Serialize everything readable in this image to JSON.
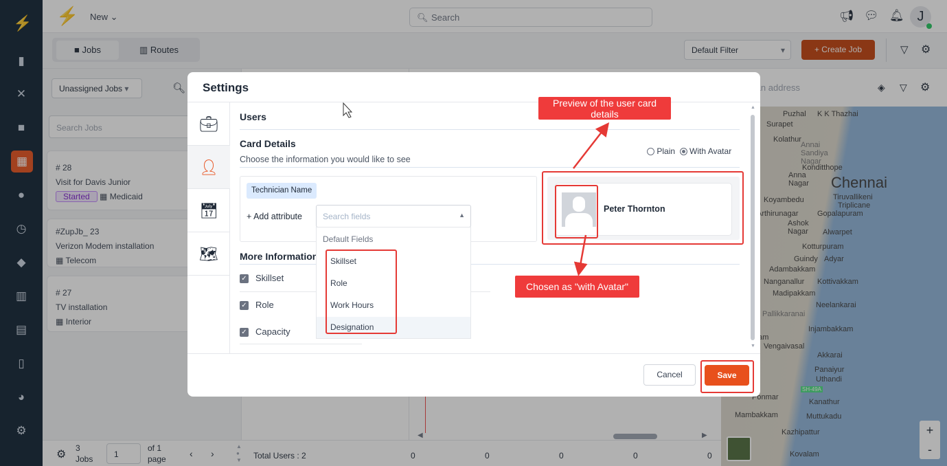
{
  "topbar": {
    "new_label": "New",
    "search_placeholder": "Search",
    "avatar_initial": "J"
  },
  "tabs": [
    {
      "label": "Jobs",
      "icon": "briefcase-icon"
    },
    {
      "label": "Routes",
      "icon": "map-icon"
    }
  ],
  "toolbar": {
    "filter_select": "Default Filter",
    "create_job": "+ Create Job"
  },
  "left_panel": {
    "jobs_filter": "Unassigned Jobs",
    "search_placeholder": "Search Jobs",
    "jobs": [
      {
        "id": "# 28",
        "title": "Visit for Davis Junior",
        "status": "Started",
        "category": "Medicaid"
      },
      {
        "id": "#ZupJb_ 23",
        "title": "Verizon Modem installation",
        "category": "Telecom"
      },
      {
        "id": "# 27",
        "title": "TV installation",
        "category": "Interior"
      }
    ]
  },
  "footer": {
    "jobs_count": "3",
    "jobs_label": "Jobs",
    "page_value": "1",
    "of_page": "of 1",
    "page_label": "page",
    "total_users": "Total Users : 2",
    "column_values": [
      "0",
      "0",
      "0",
      "0",
      "0"
    ]
  },
  "map": {
    "address_placeholder": "Enter an address",
    "zoom_in": "+",
    "zoom_out": "-",
    "places": [
      "Puzhal",
      "K K Thazhai",
      "Surapet",
      "Kolathur",
      "Annai Sandiya Nagar",
      "Konditthope",
      "Anna Nagar",
      "Chennai",
      "Koyambedu",
      "Tiruvallikeni",
      "Triplicane",
      "Arthirunagar",
      "Gopalapuram",
      "Ashok Nagar",
      "Alwarpet",
      "Kotturpuram",
      "Guindy",
      "Adyar",
      "Adambakkam",
      "Kottivakkam",
      "Nanganallur",
      "Madipakkam",
      "Neelankarai",
      "Pallikkaranai",
      "Injambakkam",
      "Medavakkam",
      "Vengaivasal",
      "Akkarai",
      "Panaiyur",
      "Uthandi",
      "SH-49A",
      "Ponmar",
      "Kanathur",
      "Mambakkam",
      "Muttukadu",
      "Kazhipattur",
      "Kovalam"
    ]
  },
  "modal": {
    "title": "Settings",
    "section": "Users",
    "card_details_title": "Card Details",
    "card_details_subtitle": "Choose the information you would like to see",
    "radio": [
      {
        "label": "Plain",
        "checked": false
      },
      {
        "label": "With Avatar",
        "checked": true
      }
    ],
    "chip": "Technician Name",
    "add_attribute": "+ Add attribute",
    "search_fields_placeholder": "Search fields",
    "dropdown_group": "Default Fields",
    "dropdown_items": [
      "Skillset",
      "Role",
      "Work Hours",
      "Designation"
    ],
    "preview_name": "Peter Thornton",
    "more_info_title": "More Information",
    "more_info_items": [
      {
        "label": "Skillset",
        "checked": true
      },
      {
        "label": "Role",
        "checked": true
      },
      {
        "label": "Capacity",
        "checked": true
      }
    ],
    "cancel": "Cancel",
    "save": "Save"
  },
  "annotations": {
    "preview": "Preview of the user card details",
    "avatar": "Chosen as \"with Avatar\""
  },
  "colors": {
    "accent": "#e8501c",
    "sidebar": "#0f2133",
    "annotation": "#ef3b3b"
  }
}
